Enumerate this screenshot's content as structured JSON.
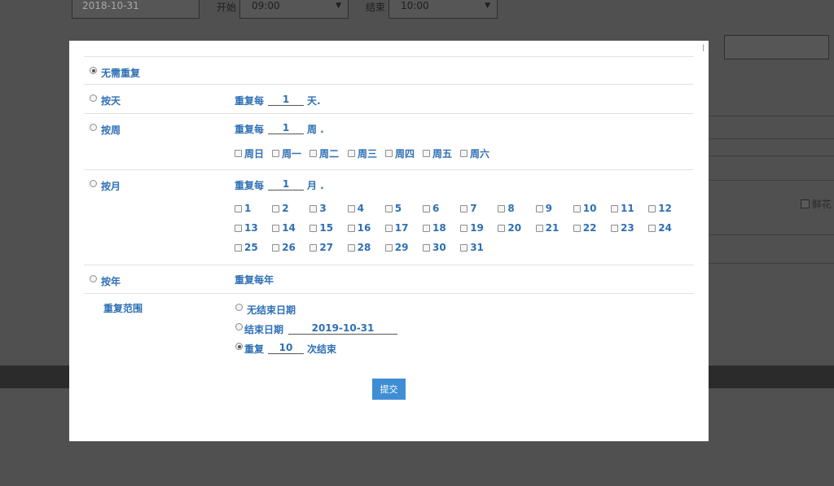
{
  "background": {
    "date_value": "2018-10-31",
    "start_label": "开始",
    "start_value": "09:00",
    "end_label": "结束",
    "end_value": "10:00",
    "flower_label": "鲜花"
  },
  "modal": {
    "options": {
      "none": "无需重复",
      "daily": "按天",
      "weekly": "按周",
      "monthly": "按月",
      "yearly": "按年"
    },
    "daily": {
      "prefix": "重复每",
      "interval": "1",
      "suffix": "天."
    },
    "weekly": {
      "prefix": "重复每",
      "interval": "1",
      "suffix": "周 .",
      "days": [
        "周日",
        "周一",
        "周二",
        "周三",
        "周四",
        "周五",
        "周六"
      ]
    },
    "monthly": {
      "prefix": "重复每",
      "interval": "1",
      "suffix": "月 .",
      "days": [
        "1",
        "2",
        "3",
        "4",
        "5",
        "6",
        "7",
        "8",
        "9",
        "10",
        "11",
        "12",
        "13",
        "14",
        "15",
        "16",
        "17",
        "18",
        "19",
        "20",
        "21",
        "22",
        "23",
        "24",
        "25",
        "26",
        "27",
        "28",
        "29",
        "30",
        "31"
      ]
    },
    "yearly": {
      "text": "重复每年"
    },
    "range": {
      "label": "重复范围",
      "no_end": "无结束日期",
      "end_date_label": "结束日期",
      "end_date_value": "2019-10-31",
      "repeat_prefix": "重复",
      "repeat_count": "10",
      "repeat_suffix": "次结束"
    },
    "submit_label": "提交"
  }
}
